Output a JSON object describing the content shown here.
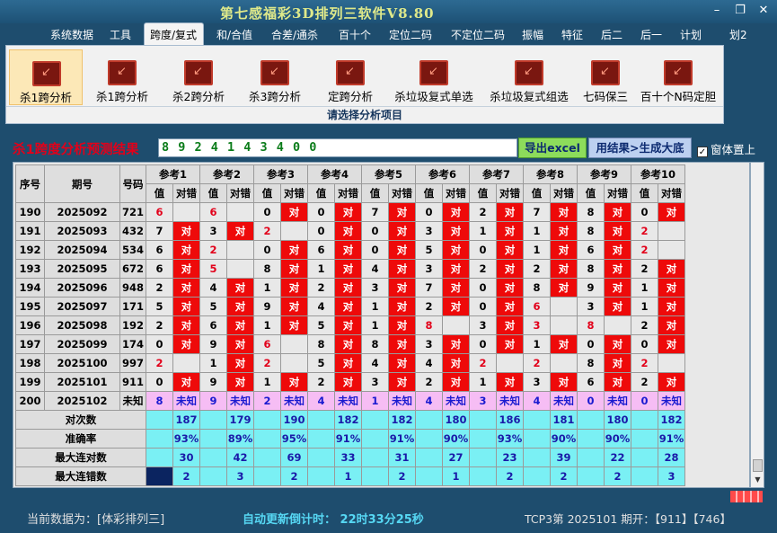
{
  "app": {
    "title": "第七感福彩3D排列三软件V8.80"
  },
  "menu": [
    "系统数据",
    "工具",
    "跨度/复式",
    "和/合值",
    "合差/通杀",
    "百十个",
    "定位二码",
    "不定位二码",
    "振幅",
    "特征",
    "后二",
    "后一",
    "计划",
    "划2"
  ],
  "ribbon": {
    "buttons": [
      "杀1跨分析",
      "杀1跨分析",
      "杀2跨分析",
      "杀3跨分析",
      "定跨分析",
      "杀垃圾复式单选",
      "杀垃圾复式组选",
      "七码保三",
      "百十个N码定胆"
    ],
    "footer": "请选择分析项目"
  },
  "result": {
    "title": "杀1跨度分析预测结果",
    "value": "8 9 2 4 1 4 3 4 0 0",
    "export_label": "导出excel",
    "generate_label": "用结果>生成大底",
    "ontop_label": "窗体置上"
  },
  "table": {
    "col_seq": "序号",
    "col_period": "期号",
    "col_num": "号码",
    "refs": [
      "参考1",
      "参考2",
      "参考3",
      "参考4",
      "参考5",
      "参考6",
      "参考7",
      "参考8",
      "参考9",
      "参考10"
    ],
    "sub_val": "值",
    "sub_res": "对错",
    "rows": [
      {
        "seq": "190",
        "period": "2025092",
        "num": "721",
        "cells": [
          [
            "6",
            ""
          ],
          [
            "6",
            ""
          ],
          [
            "0",
            "对"
          ],
          [
            "0",
            "对"
          ],
          [
            "7",
            "对"
          ],
          [
            "0",
            "对"
          ],
          [
            "2",
            "对"
          ],
          [
            "7",
            "对"
          ],
          [
            "8",
            "对"
          ],
          [
            "0",
            "对"
          ]
        ]
      },
      {
        "seq": "191",
        "period": "2025093",
        "num": "432",
        "cells": [
          [
            "7",
            "对"
          ],
          [
            "3",
            "对"
          ],
          [
            "2",
            ""
          ],
          [
            "0",
            "对"
          ],
          [
            "0",
            "对"
          ],
          [
            "3",
            "对"
          ],
          [
            "1",
            "对"
          ],
          [
            "1",
            "对"
          ],
          [
            "8",
            "对"
          ],
          [
            "2",
            ""
          ]
        ]
      },
      {
        "seq": "192",
        "period": "2025094",
        "num": "534",
        "cells": [
          [
            "6",
            "对"
          ],
          [
            "2",
            ""
          ],
          [
            "0",
            "对"
          ],
          [
            "6",
            "对"
          ],
          [
            "0",
            "对"
          ],
          [
            "5",
            "对"
          ],
          [
            "0",
            "对"
          ],
          [
            "1",
            "对"
          ],
          [
            "6",
            "对"
          ],
          [
            "2",
            ""
          ]
        ]
      },
      {
        "seq": "193",
        "period": "2025095",
        "num": "672",
        "cells": [
          [
            "6",
            "对"
          ],
          [
            "5",
            ""
          ],
          [
            "8",
            "对"
          ],
          [
            "1",
            "对"
          ],
          [
            "4",
            "对"
          ],
          [
            "3",
            "对"
          ],
          [
            "2",
            "对"
          ],
          [
            "2",
            "对"
          ],
          [
            "8",
            "对"
          ],
          [
            "2",
            "对"
          ]
        ]
      },
      {
        "seq": "194",
        "period": "2025096",
        "num": "948",
        "cells": [
          [
            "2",
            "对"
          ],
          [
            "4",
            "对"
          ],
          [
            "1",
            "对"
          ],
          [
            "2",
            "对"
          ],
          [
            "3",
            "对"
          ],
          [
            "7",
            "对"
          ],
          [
            "0",
            "对"
          ],
          [
            "8",
            "对"
          ],
          [
            "9",
            "对"
          ],
          [
            "1",
            "对"
          ]
        ]
      },
      {
        "seq": "195",
        "period": "2025097",
        "num": "171",
        "cells": [
          [
            "5",
            "对"
          ],
          [
            "5",
            "对"
          ],
          [
            "9",
            "对"
          ],
          [
            "4",
            "对"
          ],
          [
            "1",
            "对"
          ],
          [
            "2",
            "对"
          ],
          [
            "0",
            "对"
          ],
          [
            "6",
            ""
          ],
          [
            "3",
            "对"
          ],
          [
            "1",
            "对"
          ]
        ]
      },
      {
        "seq": "196",
        "period": "2025098",
        "num": "192",
        "cells": [
          [
            "2",
            "对"
          ],
          [
            "6",
            "对"
          ],
          [
            "1",
            "对"
          ],
          [
            "5",
            "对"
          ],
          [
            "1",
            "对"
          ],
          [
            "8",
            ""
          ],
          [
            "3",
            "对"
          ],
          [
            "3",
            ""
          ],
          [
            "8",
            ""
          ],
          [
            "2",
            "对"
          ]
        ]
      },
      {
        "seq": "197",
        "period": "2025099",
        "num": "174",
        "cells": [
          [
            "0",
            "对"
          ],
          [
            "9",
            "对"
          ],
          [
            "6",
            ""
          ],
          [
            "8",
            "对"
          ],
          [
            "8",
            "对"
          ],
          [
            "3",
            "对"
          ],
          [
            "0",
            "对"
          ],
          [
            "1",
            "对"
          ],
          [
            "0",
            "对"
          ],
          [
            "0",
            "对"
          ]
        ]
      },
      {
        "seq": "198",
        "period": "2025100",
        "num": "997",
        "cells": [
          [
            "2",
            ""
          ],
          [
            "1",
            "对"
          ],
          [
            "2",
            ""
          ],
          [
            "5",
            "对"
          ],
          [
            "4",
            "对"
          ],
          [
            "4",
            "对"
          ],
          [
            "2",
            ""
          ],
          [
            "2",
            ""
          ],
          [
            "8",
            "对"
          ],
          [
            "2",
            ""
          ]
        ]
      },
      {
        "seq": "199",
        "period": "2025101",
        "num": "911",
        "cells": [
          [
            "0",
            "对"
          ],
          [
            "9",
            "对"
          ],
          [
            "1",
            "对"
          ],
          [
            "2",
            "对"
          ],
          [
            "3",
            "对"
          ],
          [
            "2",
            "对"
          ],
          [
            "1",
            "对"
          ],
          [
            "3",
            "对"
          ],
          [
            "6",
            "对"
          ],
          [
            "2",
            "对"
          ]
        ]
      }
    ],
    "unknown_row": {
      "seq": "200",
      "period": "2025102",
      "num": "未知",
      "values": [
        "8",
        "9",
        "2",
        "4",
        "1",
        "4",
        "3",
        "4",
        "0",
        "0"
      ],
      "res_label": "未知"
    },
    "stats": [
      {
        "label": "对次数",
        "values": [
          "187",
          "179",
          "190",
          "182",
          "182",
          "180",
          "186",
          "181",
          "180",
          "182"
        ]
      },
      {
        "label": "准确率",
        "values": [
          "93%",
          "89%",
          "95%",
          "91%",
          "91%",
          "90%",
          "93%",
          "90%",
          "90%",
          "91%"
        ]
      },
      {
        "label": "最大连对数",
        "values": [
          "30",
          "42",
          "69",
          "33",
          "31",
          "27",
          "23",
          "39",
          "22",
          "28"
        ]
      },
      {
        "label": "最大连错数",
        "values": [
          "2",
          "3",
          "2",
          "1",
          "2",
          "1",
          "2",
          "2",
          "2",
          "3"
        ]
      }
    ]
  },
  "status": {
    "current": "当前数据为：[体彩排列三]",
    "countdown": "自动更新倒计时： 22时33分25秒",
    "info": "TCP3第 2025101 期开：【911】【746】"
  },
  "colors": {
    "hit": "#ee0a0a",
    "unknown": "#f6bdf4",
    "stats": "#7af0f4",
    "result_text": "#0b7c1a"
  }
}
